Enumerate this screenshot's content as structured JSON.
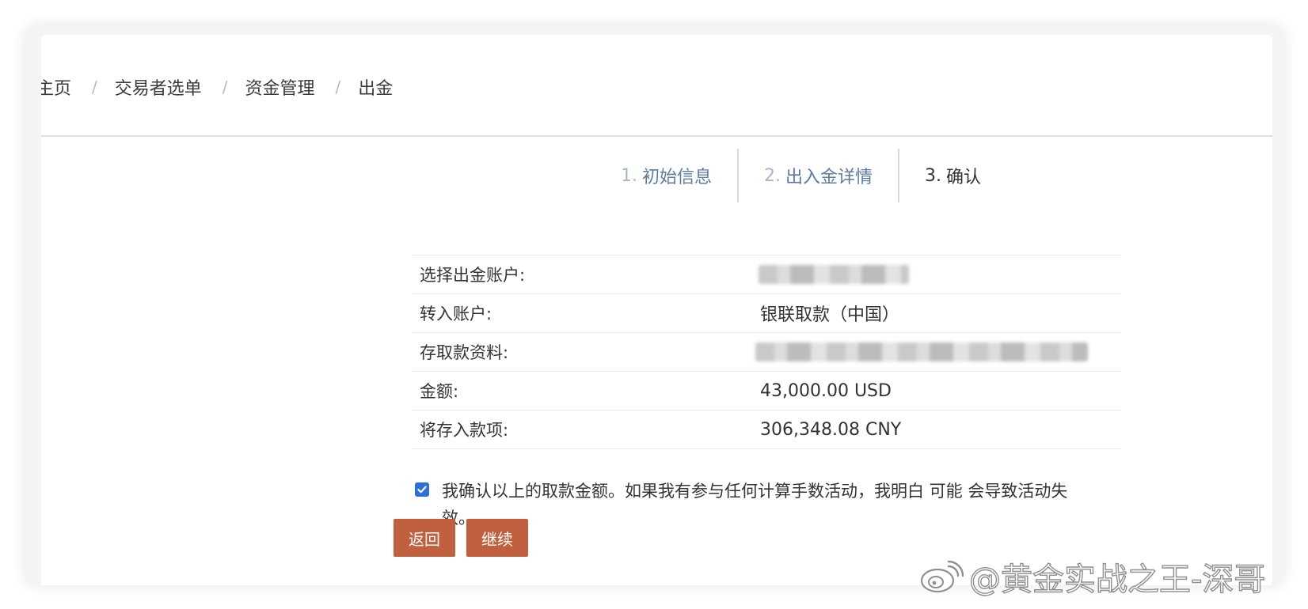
{
  "breadcrumb": {
    "items": [
      "主页",
      "交易者选单",
      "资金管理",
      "出金"
    ],
    "separator": "/"
  },
  "steps": [
    {
      "num": "1.",
      "label": "初始信息",
      "active": false
    },
    {
      "num": "2.",
      "label": "出入金详情",
      "active": false
    },
    {
      "num": "3.",
      "label": "确认",
      "active": true
    }
  ],
  "details": {
    "rows": [
      {
        "label": "选择出金账户:",
        "value": null,
        "redacted": true
      },
      {
        "label": "转入账户:",
        "value": "银联取款（中国）",
        "redacted": false
      },
      {
        "label": "存取款资料:",
        "value": null,
        "redacted": true
      },
      {
        "label": "金额:",
        "value": "43,000.00 USD",
        "redacted": false
      },
      {
        "label": "将存入款项:",
        "value": "306,348.08 CNY",
        "redacted": false
      }
    ]
  },
  "confirm": {
    "checked": true,
    "text": "我确认以上的取款金额。如果我有参与任何计算手数活动，我明白 可能 会导致活动失效。"
  },
  "buttons": {
    "back": "返回",
    "continue": "继续"
  },
  "watermark": {
    "text": "@黄金实战之王-深哥",
    "icon": "weibo-logo"
  },
  "colors": {
    "button": "#c0603f",
    "step_link": "#5b7ba3",
    "checkbox": "#2f6fd6"
  }
}
